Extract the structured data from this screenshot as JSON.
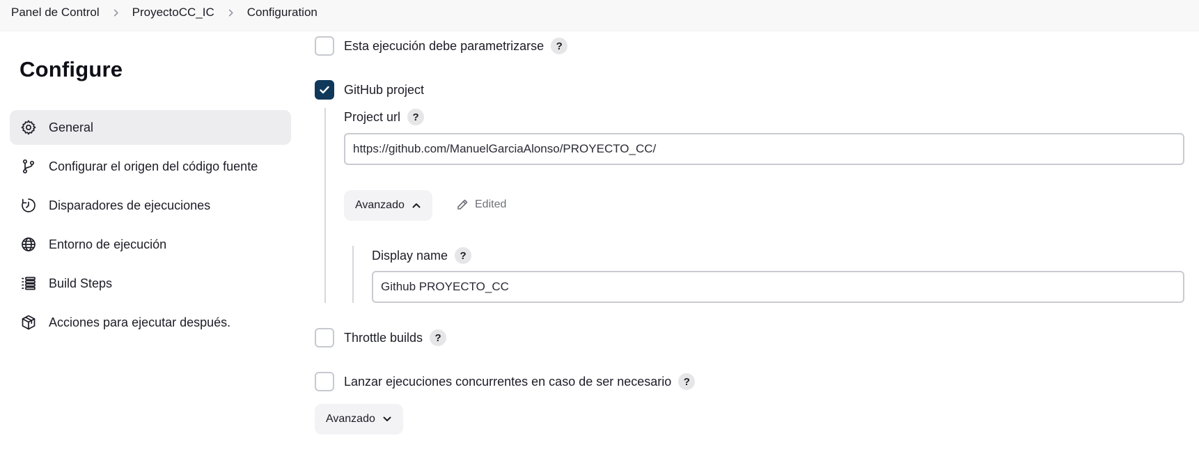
{
  "breadcrumb": {
    "items": [
      "Panel de Control",
      "ProyectoCC_IC",
      "Configuration"
    ]
  },
  "sidebar": {
    "title": "Configure",
    "items": [
      {
        "label": "General",
        "icon": "gear-icon",
        "active": true
      },
      {
        "label": "Configurar el origen del código fuente",
        "icon": "branch-icon",
        "active": false
      },
      {
        "label": "Disparadores de ejecuciones",
        "icon": "clock-icon",
        "active": false
      },
      {
        "label": "Entorno de ejecución",
        "icon": "globe-icon",
        "active": false
      },
      {
        "label": "Build Steps",
        "icon": "list-icon",
        "active": false
      },
      {
        "label": "Acciones para ejecutar después.",
        "icon": "package-icon",
        "active": false
      }
    ]
  },
  "form": {
    "parametrized": {
      "label": "Esta ejecución debe parametrizarse",
      "checked": false
    },
    "github_project": {
      "label": "GitHub project",
      "checked": true,
      "project_url_label": "Project url",
      "project_url_value": "https://github.com/ManuelGarciaAlonso/PROYECTO_CC/",
      "advanced_label": "Avanzado",
      "edited_label": "Edited",
      "display_name_label": "Display name",
      "display_name_value": "Github PROYECTO_CC"
    },
    "throttle": {
      "label": "Throttle builds",
      "checked": false
    },
    "concurrent": {
      "label": "Lanzar ejecuciones concurrentes en caso de ser necesario",
      "checked": false
    },
    "advanced_bottom_label": "Avanzado",
    "help_glyph": "?"
  },
  "colors": {
    "checkbox_checked": "#10385a",
    "sidebar_active_bg": "#ededf0",
    "help_bg": "#e6e6e9"
  }
}
